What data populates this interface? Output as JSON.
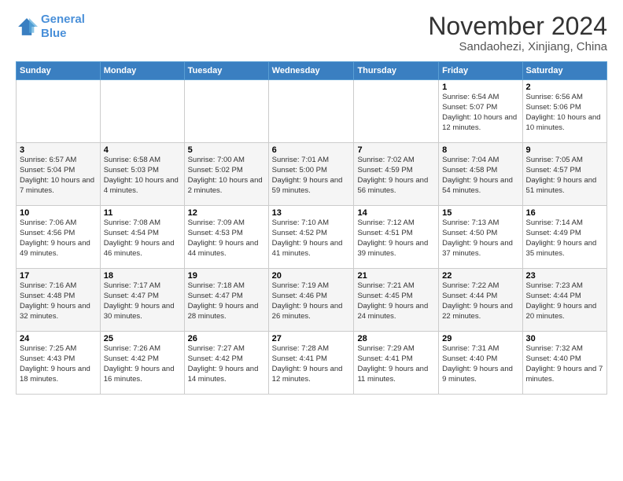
{
  "header": {
    "logo_line1": "General",
    "logo_line2": "Blue",
    "main_title": "November 2024",
    "sub_title": "Sandaohezi, Xinjiang, China"
  },
  "weekdays": [
    "Sunday",
    "Monday",
    "Tuesday",
    "Wednesday",
    "Thursday",
    "Friday",
    "Saturday"
  ],
  "weeks": [
    [
      {
        "day": "",
        "info": ""
      },
      {
        "day": "",
        "info": ""
      },
      {
        "day": "",
        "info": ""
      },
      {
        "day": "",
        "info": ""
      },
      {
        "day": "",
        "info": ""
      },
      {
        "day": "1",
        "info": "Sunrise: 6:54 AM\nSunset: 5:07 PM\nDaylight: 10 hours and 12 minutes."
      },
      {
        "day": "2",
        "info": "Sunrise: 6:56 AM\nSunset: 5:06 PM\nDaylight: 10 hours and 10 minutes."
      }
    ],
    [
      {
        "day": "3",
        "info": "Sunrise: 6:57 AM\nSunset: 5:04 PM\nDaylight: 10 hours and 7 minutes."
      },
      {
        "day": "4",
        "info": "Sunrise: 6:58 AM\nSunset: 5:03 PM\nDaylight: 10 hours and 4 minutes."
      },
      {
        "day": "5",
        "info": "Sunrise: 7:00 AM\nSunset: 5:02 PM\nDaylight: 10 hours and 2 minutes."
      },
      {
        "day": "6",
        "info": "Sunrise: 7:01 AM\nSunset: 5:00 PM\nDaylight: 9 hours and 59 minutes."
      },
      {
        "day": "7",
        "info": "Sunrise: 7:02 AM\nSunset: 4:59 PM\nDaylight: 9 hours and 56 minutes."
      },
      {
        "day": "8",
        "info": "Sunrise: 7:04 AM\nSunset: 4:58 PM\nDaylight: 9 hours and 54 minutes."
      },
      {
        "day": "9",
        "info": "Sunrise: 7:05 AM\nSunset: 4:57 PM\nDaylight: 9 hours and 51 minutes."
      }
    ],
    [
      {
        "day": "10",
        "info": "Sunrise: 7:06 AM\nSunset: 4:56 PM\nDaylight: 9 hours and 49 minutes."
      },
      {
        "day": "11",
        "info": "Sunrise: 7:08 AM\nSunset: 4:54 PM\nDaylight: 9 hours and 46 minutes."
      },
      {
        "day": "12",
        "info": "Sunrise: 7:09 AM\nSunset: 4:53 PM\nDaylight: 9 hours and 44 minutes."
      },
      {
        "day": "13",
        "info": "Sunrise: 7:10 AM\nSunset: 4:52 PM\nDaylight: 9 hours and 41 minutes."
      },
      {
        "day": "14",
        "info": "Sunrise: 7:12 AM\nSunset: 4:51 PM\nDaylight: 9 hours and 39 minutes."
      },
      {
        "day": "15",
        "info": "Sunrise: 7:13 AM\nSunset: 4:50 PM\nDaylight: 9 hours and 37 minutes."
      },
      {
        "day": "16",
        "info": "Sunrise: 7:14 AM\nSunset: 4:49 PM\nDaylight: 9 hours and 35 minutes."
      }
    ],
    [
      {
        "day": "17",
        "info": "Sunrise: 7:16 AM\nSunset: 4:48 PM\nDaylight: 9 hours and 32 minutes."
      },
      {
        "day": "18",
        "info": "Sunrise: 7:17 AM\nSunset: 4:47 PM\nDaylight: 9 hours and 30 minutes."
      },
      {
        "day": "19",
        "info": "Sunrise: 7:18 AM\nSunset: 4:47 PM\nDaylight: 9 hours and 28 minutes."
      },
      {
        "day": "20",
        "info": "Sunrise: 7:19 AM\nSunset: 4:46 PM\nDaylight: 9 hours and 26 minutes."
      },
      {
        "day": "21",
        "info": "Sunrise: 7:21 AM\nSunset: 4:45 PM\nDaylight: 9 hours and 24 minutes."
      },
      {
        "day": "22",
        "info": "Sunrise: 7:22 AM\nSunset: 4:44 PM\nDaylight: 9 hours and 22 minutes."
      },
      {
        "day": "23",
        "info": "Sunrise: 7:23 AM\nSunset: 4:44 PM\nDaylight: 9 hours and 20 minutes."
      }
    ],
    [
      {
        "day": "24",
        "info": "Sunrise: 7:25 AM\nSunset: 4:43 PM\nDaylight: 9 hours and 18 minutes."
      },
      {
        "day": "25",
        "info": "Sunrise: 7:26 AM\nSunset: 4:42 PM\nDaylight: 9 hours and 16 minutes."
      },
      {
        "day": "26",
        "info": "Sunrise: 7:27 AM\nSunset: 4:42 PM\nDaylight: 9 hours and 14 minutes."
      },
      {
        "day": "27",
        "info": "Sunrise: 7:28 AM\nSunset: 4:41 PM\nDaylight: 9 hours and 12 minutes."
      },
      {
        "day": "28",
        "info": "Sunrise: 7:29 AM\nSunset: 4:41 PM\nDaylight: 9 hours and 11 minutes."
      },
      {
        "day": "29",
        "info": "Sunrise: 7:31 AM\nSunset: 4:40 PM\nDaylight: 9 hours and 9 minutes."
      },
      {
        "day": "30",
        "info": "Sunrise: 7:32 AM\nSunset: 4:40 PM\nDaylight: 9 hours and 7 minutes."
      }
    ]
  ]
}
